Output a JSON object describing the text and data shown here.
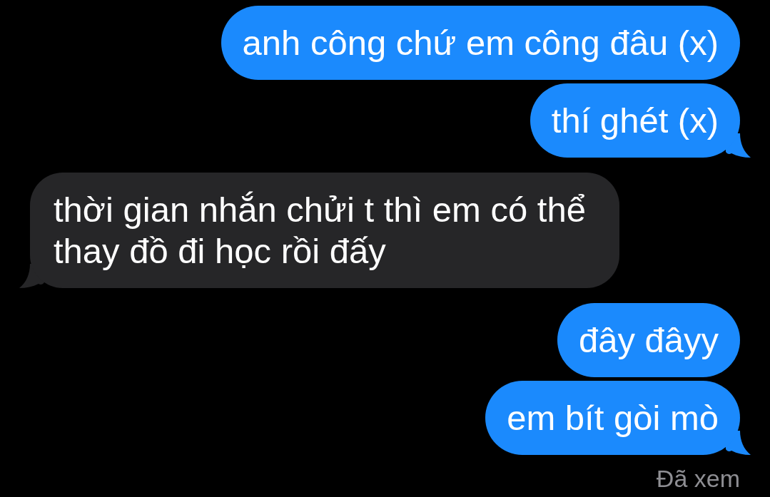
{
  "messages": [
    {
      "kind": "outgoing",
      "text": "anh công chứ em công đâu (x)",
      "tail": false
    },
    {
      "kind": "outgoing",
      "text": "thí ghét (x)",
      "tail": true
    },
    {
      "kind": "incoming",
      "text": "thời gian nhắn chửi t thì em có thể thay đồ đi học rồi đấy",
      "tail": true
    },
    {
      "kind": "outgoing",
      "text": "đây đâyy",
      "tail": false
    },
    {
      "kind": "outgoing",
      "text": "em bít gòi mò",
      "tail": true
    }
  ],
  "read_receipt": "Đã xem"
}
